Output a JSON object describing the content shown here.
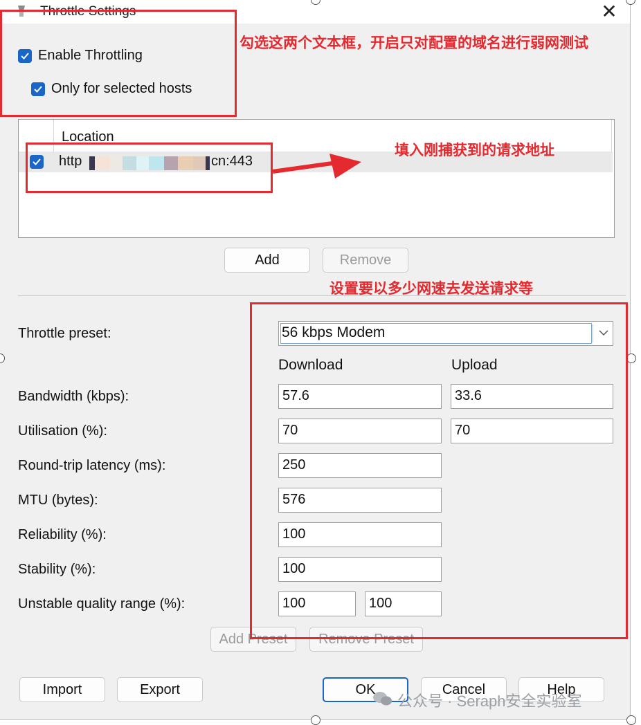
{
  "window": {
    "title": "Throttle Settings",
    "close_icon": "close-icon",
    "close_glyph": "✕"
  },
  "options": {
    "enable_throttling": {
      "label": "Enable Throttling",
      "checked": true
    },
    "only_selected_hosts": {
      "label": "Only for selected hosts",
      "checked": true
    }
  },
  "hosts": {
    "column_header": "Location",
    "rows": [
      {
        "checked": true,
        "prefix": "http",
        "suffix": "cn:443"
      }
    ],
    "add_label": "Add",
    "remove_label": "Remove"
  },
  "throttle": {
    "preset_label": "Throttle preset:",
    "preset_value": "56 kbps Modem",
    "download_header": "Download",
    "upload_header": "Upload",
    "bandwidth_label": "Bandwidth (kbps):",
    "bandwidth_download": "57.6",
    "bandwidth_upload": "33.6",
    "utilisation_label": "Utilisation (%):",
    "utilisation_download": "70",
    "utilisation_upload": "70",
    "latency_label": "Round-trip latency (ms):",
    "latency_value": "250",
    "mtu_label": "MTU (bytes):",
    "mtu_value": "576",
    "reliability_label": "Reliability (%):",
    "reliability_value": "100",
    "stability_label": "Stability (%):",
    "stability_value": "100",
    "unstable_label": "Unstable quality range (%):",
    "unstable_min": "100",
    "unstable_max": "100",
    "add_preset_label": "Add Preset",
    "remove_preset_label": "Remove Preset"
  },
  "footer": {
    "import_label": "Import",
    "export_label": "Export",
    "ok_label": "OK",
    "cancel_label": "Cancel",
    "help_label": "Help"
  },
  "annotations": {
    "checkboxes_note": "勾选这两个文本框，开启只对配置的域名进行弱网测试",
    "host_note": "填入刚捕获到的请求地址",
    "speed_note": "设置要以多少网速去发送请求等",
    "color": "#e4292f"
  },
  "watermark": {
    "text": "公众号 · Seraph安全实验室",
    "icon": "wechat-icon"
  }
}
